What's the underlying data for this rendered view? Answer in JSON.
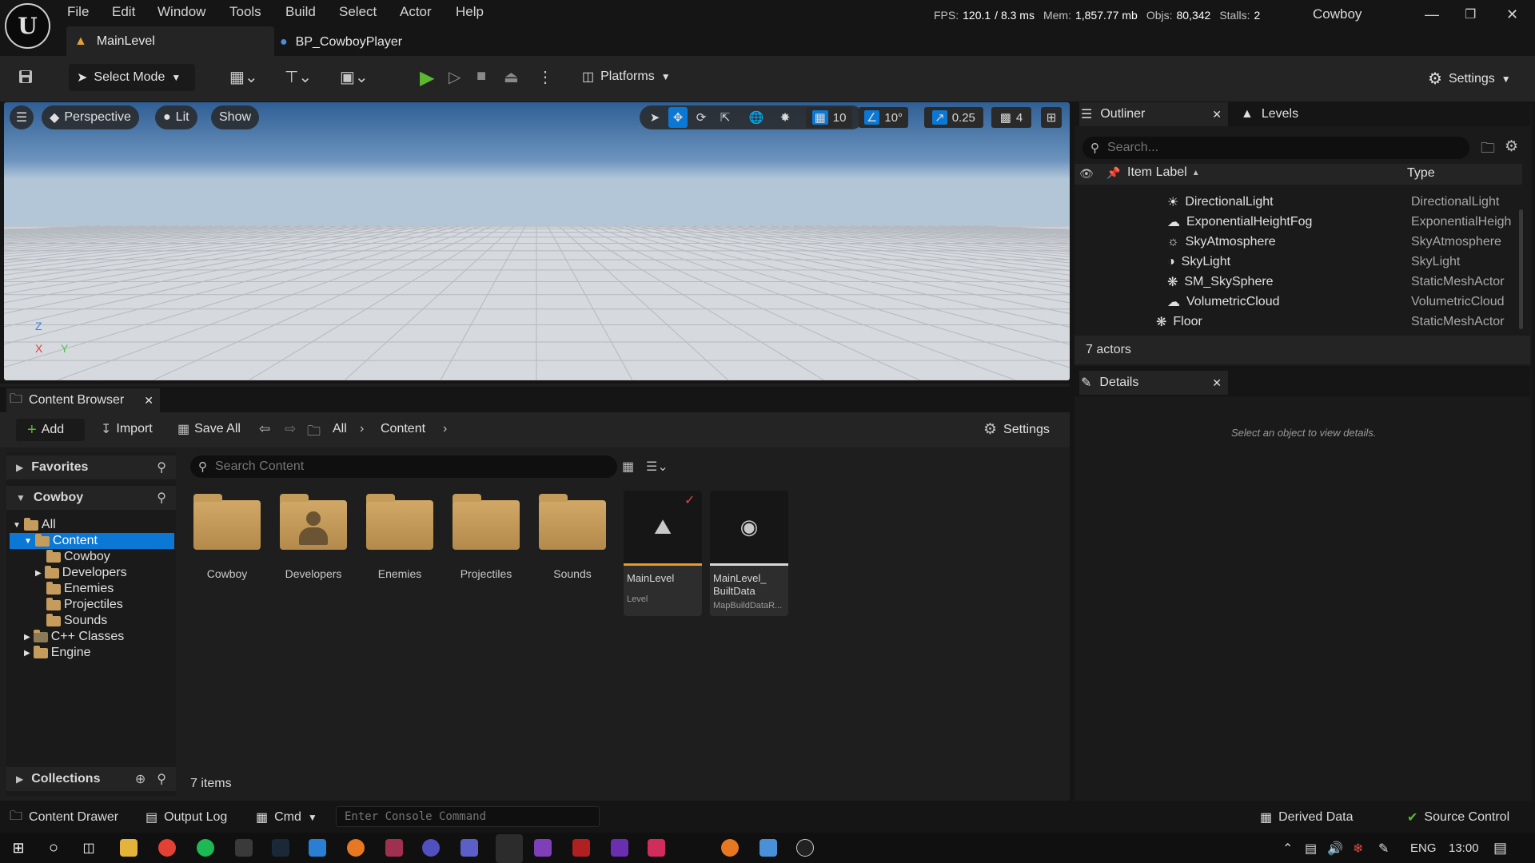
{
  "menu": [
    "File",
    "Edit",
    "Window",
    "Tools",
    "Build",
    "Select",
    "Actor",
    "Help"
  ],
  "stats": {
    "fps_label": "FPS:",
    "fps": "120.1",
    "ms": "/ 8.3 ms",
    "mem_label": "Mem:",
    "mem": "1,857.77 mb",
    "objs_label": "Objs:",
    "objs": "80,342",
    "stalls_label": "Stalls:",
    "stalls": "2"
  },
  "project_name": "Cowboy",
  "logo_letter": "U",
  "tabs": {
    "main": "MainLevel",
    "bp": "BP_CowboyPlayer"
  },
  "toolbar": {
    "select_mode": "Select Mode",
    "platforms": "Platforms",
    "settings": "Settings"
  },
  "viewport": {
    "perspective": "Perspective",
    "lit": "Lit",
    "show": "Show",
    "grid_snap": "10",
    "rot_snap": "10°",
    "scale_snap": "0.25",
    "cam_speed": "4",
    "axis_z": "Z",
    "axis_x": "X",
    "axis_y": "Y"
  },
  "outliner": {
    "tab": "Outliner",
    "levels_tab": "Levels",
    "search_placeholder": "Search...",
    "col_label": "Item Label",
    "col_type": "Type",
    "rows": [
      {
        "label": "DirectionalLight",
        "type": "DirectionalLight"
      },
      {
        "label": "ExponentialHeightFog",
        "type": "ExponentialHeigh"
      },
      {
        "label": "SkyAtmosphere",
        "type": "SkyAtmosphere"
      },
      {
        "label": "SkyLight",
        "type": "SkyLight"
      },
      {
        "label": "SM_SkySphere",
        "type": "StaticMeshActor"
      },
      {
        "label": "VolumetricCloud",
        "type": "VolumetricCloud"
      },
      {
        "label": "Floor",
        "type": "StaticMeshActor"
      }
    ],
    "count": "7 actors"
  },
  "details": {
    "tab": "Details",
    "empty": "Select an object to view details."
  },
  "content_browser": {
    "tab": "Content Browser",
    "add": "Add",
    "import": "Import",
    "save_all": "Save All",
    "crumb_all": "All",
    "crumb_content": "Content",
    "settings": "Settings",
    "favorites": "Favorites",
    "project": "Cowboy",
    "tree": {
      "all": "All",
      "content": "Content",
      "cowboy": "Cowboy",
      "developers": "Developers",
      "enemies": "Enemies",
      "projectiles": "Projectiles",
      "sounds": "Sounds",
      "cpp": "C++ Classes",
      "engine": "Engine"
    },
    "collections": "Collections",
    "search_placeholder": "Search Content",
    "assets": [
      "Cowboy",
      "Developers",
      "Enemies",
      "Projectiles",
      "Sounds"
    ],
    "level": {
      "name": "MainLevel",
      "type": "Level"
    },
    "builtdata": {
      "name_1": "MainLevel_",
      "name_2": "BuiltData",
      "type": "MapBuildDataR..."
    },
    "items_count": "7 items"
  },
  "statusbar": {
    "content_drawer": "Content Drawer",
    "output_log": "Output Log",
    "cmd": "Cmd",
    "console_placeholder": "Enter Console Command",
    "derived_data": "Derived Data",
    "source_control": "Source Control"
  },
  "taskbar": {
    "lang": "ENG",
    "time": "13:00"
  },
  "colors": {
    "accent_blue": "#0b78d6",
    "play_green": "#5cb82f",
    "folder": "#c69c5d",
    "selection": "#1c5fa8"
  }
}
